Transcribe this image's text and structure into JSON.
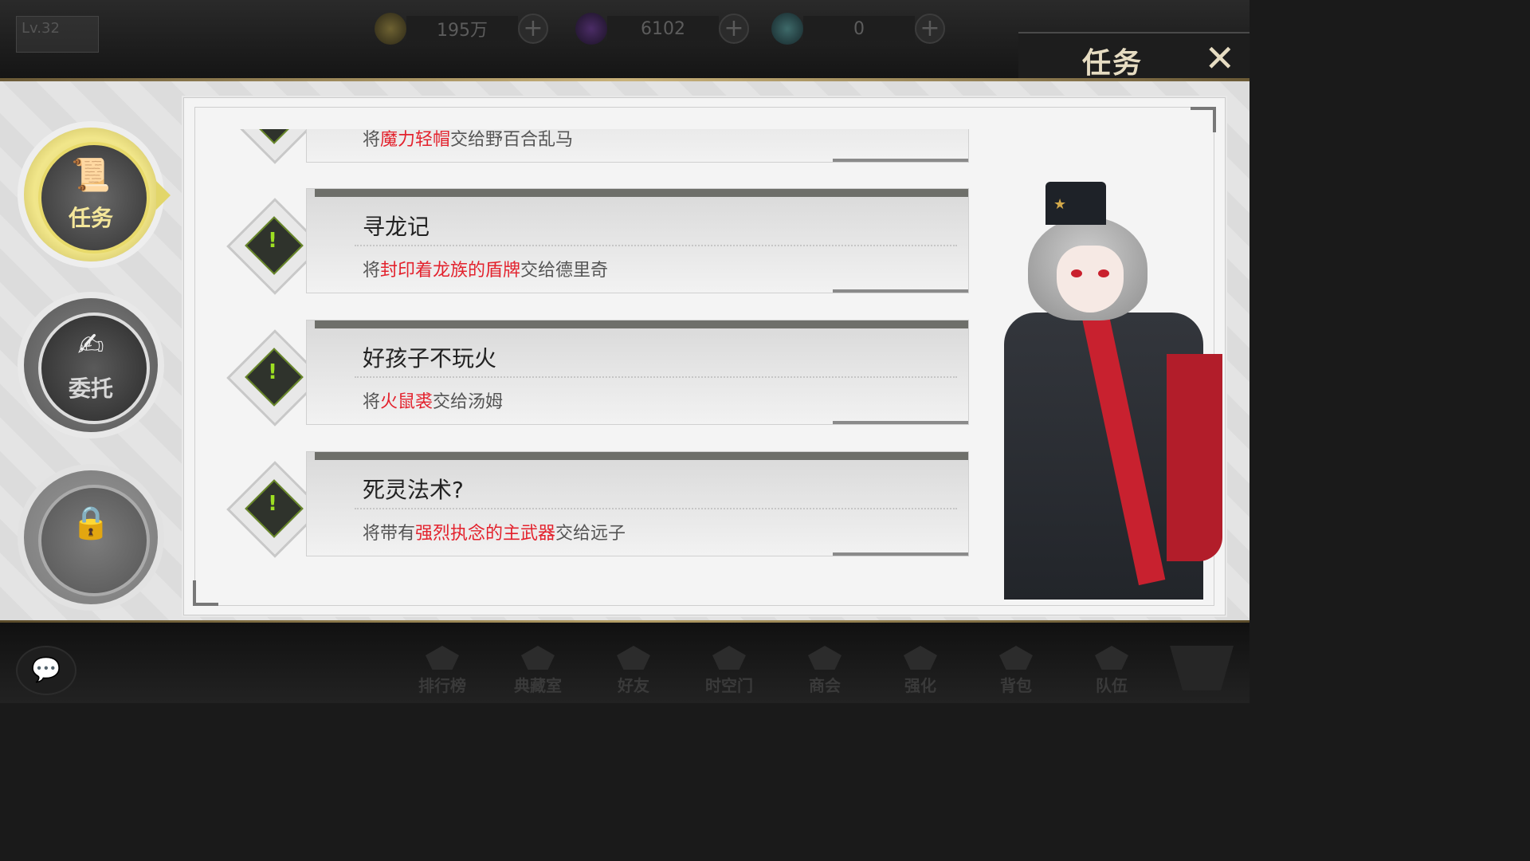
{
  "header": {
    "level": "Lv.32",
    "gold": "195万",
    "crystal": "6102",
    "token": "0",
    "plus": "+",
    "title": "任务",
    "close": "✕"
  },
  "sidebar": {
    "task_label": "任务",
    "commission_label": "委托",
    "locked_label": ""
  },
  "quests": [
    {
      "name": "",
      "desc_pre": "将",
      "desc_hl": "魔力轻帽",
      "desc_post": "交给野百合乱马"
    },
    {
      "name": "寻龙记",
      "desc_pre": "将",
      "desc_hl": "封印着龙族的盾牌",
      "desc_post": "交给德里奇"
    },
    {
      "name": "好孩子不玩火",
      "desc_pre": "将",
      "desc_hl": "火鼠裘",
      "desc_post": "交给汤姆"
    },
    {
      "name": "死灵法术?",
      "desc_pre": "将带有",
      "desc_hl": "强烈执念的主武器",
      "desc_post": "交给远子"
    }
  ],
  "quest_icon": "!",
  "bottom_nav": [
    "排行榜",
    "典藏室",
    "好友",
    "时空门",
    "商会",
    "强化",
    "背包",
    "队伍"
  ],
  "colors": {
    "highlight_red": "#e3222d",
    "quest_icon_green": "#9ddf22",
    "title_gold": "#e6dcc2"
  }
}
